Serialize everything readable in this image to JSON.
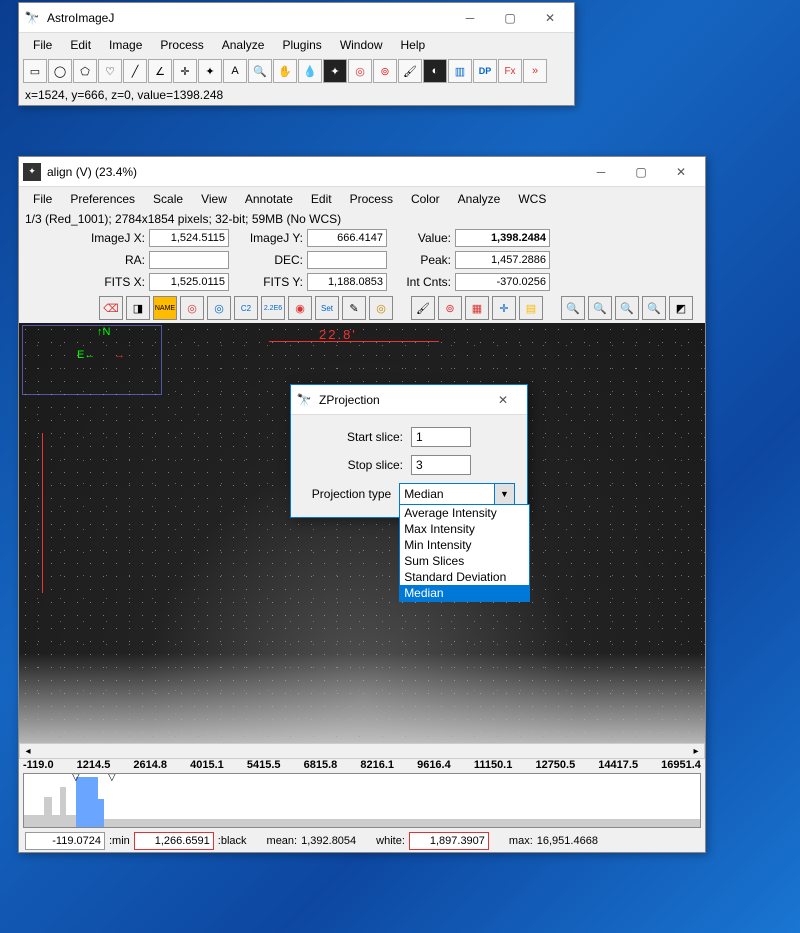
{
  "main": {
    "title": "AstroImageJ",
    "menus": [
      "File",
      "Edit",
      "Image",
      "Process",
      "Analyze",
      "Plugins",
      "Window",
      "Help"
    ],
    "status": "x=1524, y=666, z=0, value=1398.248"
  },
  "img": {
    "title": "align (V) (23.4%)",
    "menus": [
      "File",
      "Preferences",
      "Scale",
      "View",
      "Annotate",
      "Edit",
      "Process",
      "Color",
      "Analyze",
      "WCS"
    ],
    "info": "1/3 (Red_1001); 2784x1854 pixels; 32-bit; 59MB (No WCS)",
    "coords": {
      "imagej_x_label": "ImageJ X:",
      "imagej_x": "1,524.5115",
      "imagej_y_label": "ImageJ Y:",
      "imagej_y": "666.4147",
      "value_label": "Value:",
      "value": "1,398.2484",
      "ra_label": "RA:",
      "ra": "",
      "dec_label": "DEC:",
      "dec": "",
      "peak_label": "Peak:",
      "peak": "1,457.2886",
      "fits_x_label": "FITS X:",
      "fits_x": "1,525.0115",
      "fits_y_label": "FITS Y:",
      "fits_y": "1,188.0853",
      "intcnts_label": "Int Cnts:",
      "intcnts": "-370.0256"
    },
    "scale_label": "22.8'",
    "ticks": [
      "-119.0",
      "1214.5",
      "2614.8",
      "4015.1",
      "5415.5",
      "6815.8",
      "8216.1",
      "9616.4",
      "11150.1",
      "12750.5",
      "14417.5",
      "16951.4"
    ],
    "stats": {
      "min_val": "-119.0724",
      "min_label": ":min",
      "black_val": "1,266.6591",
      "black_label": ":black",
      "mean_label": "mean:",
      "mean_val": "1,392.8054",
      "white_label": "white:",
      "white_val": "1,897.3907",
      "max_label": "max:",
      "max_val": "16,951.4668"
    }
  },
  "zproj": {
    "title": "ZProjection",
    "start_label": "Start slice:",
    "start": "1",
    "stop_label": "Stop slice:",
    "stop": "3",
    "type_label": "Projection type",
    "selected": "Median",
    "options": [
      "Average Intensity",
      "Max Intensity",
      "Min Intensity",
      "Sum Slices",
      "Standard Deviation",
      "Median"
    ]
  }
}
